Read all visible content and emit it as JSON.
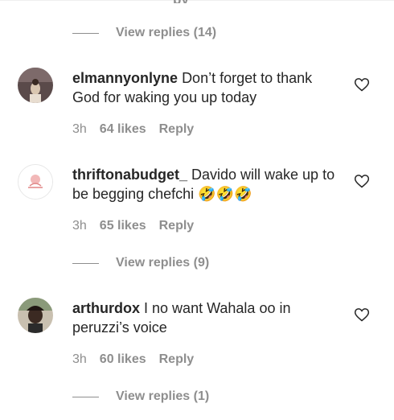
{
  "top": {
    "partial_label": "py"
  },
  "view_replies": [
    {
      "label": "View replies (14)"
    },
    {
      "label": "View replies (9)"
    },
    {
      "label": "View replies (1)"
    }
  ],
  "comments": [
    {
      "username": "elmannyonlyne",
      "text": "Don’t forget to thank God for waking you up today",
      "time": "3h",
      "likes": "64 likes",
      "reply": "Reply"
    },
    {
      "username": "thriftonabudget_",
      "text": "Davido will wake up to be begging chefchi",
      "emoji": "🤣🤣🤣",
      "time": "3h",
      "likes": "65 likes",
      "reply": "Reply"
    },
    {
      "username": "arthurdox",
      "text": "I no want Wahala oo in peruzzi’s voice",
      "time": "3h",
      "likes": "60 likes",
      "reply": "Reply"
    }
  ],
  "icons": {
    "like": "heart-icon"
  }
}
